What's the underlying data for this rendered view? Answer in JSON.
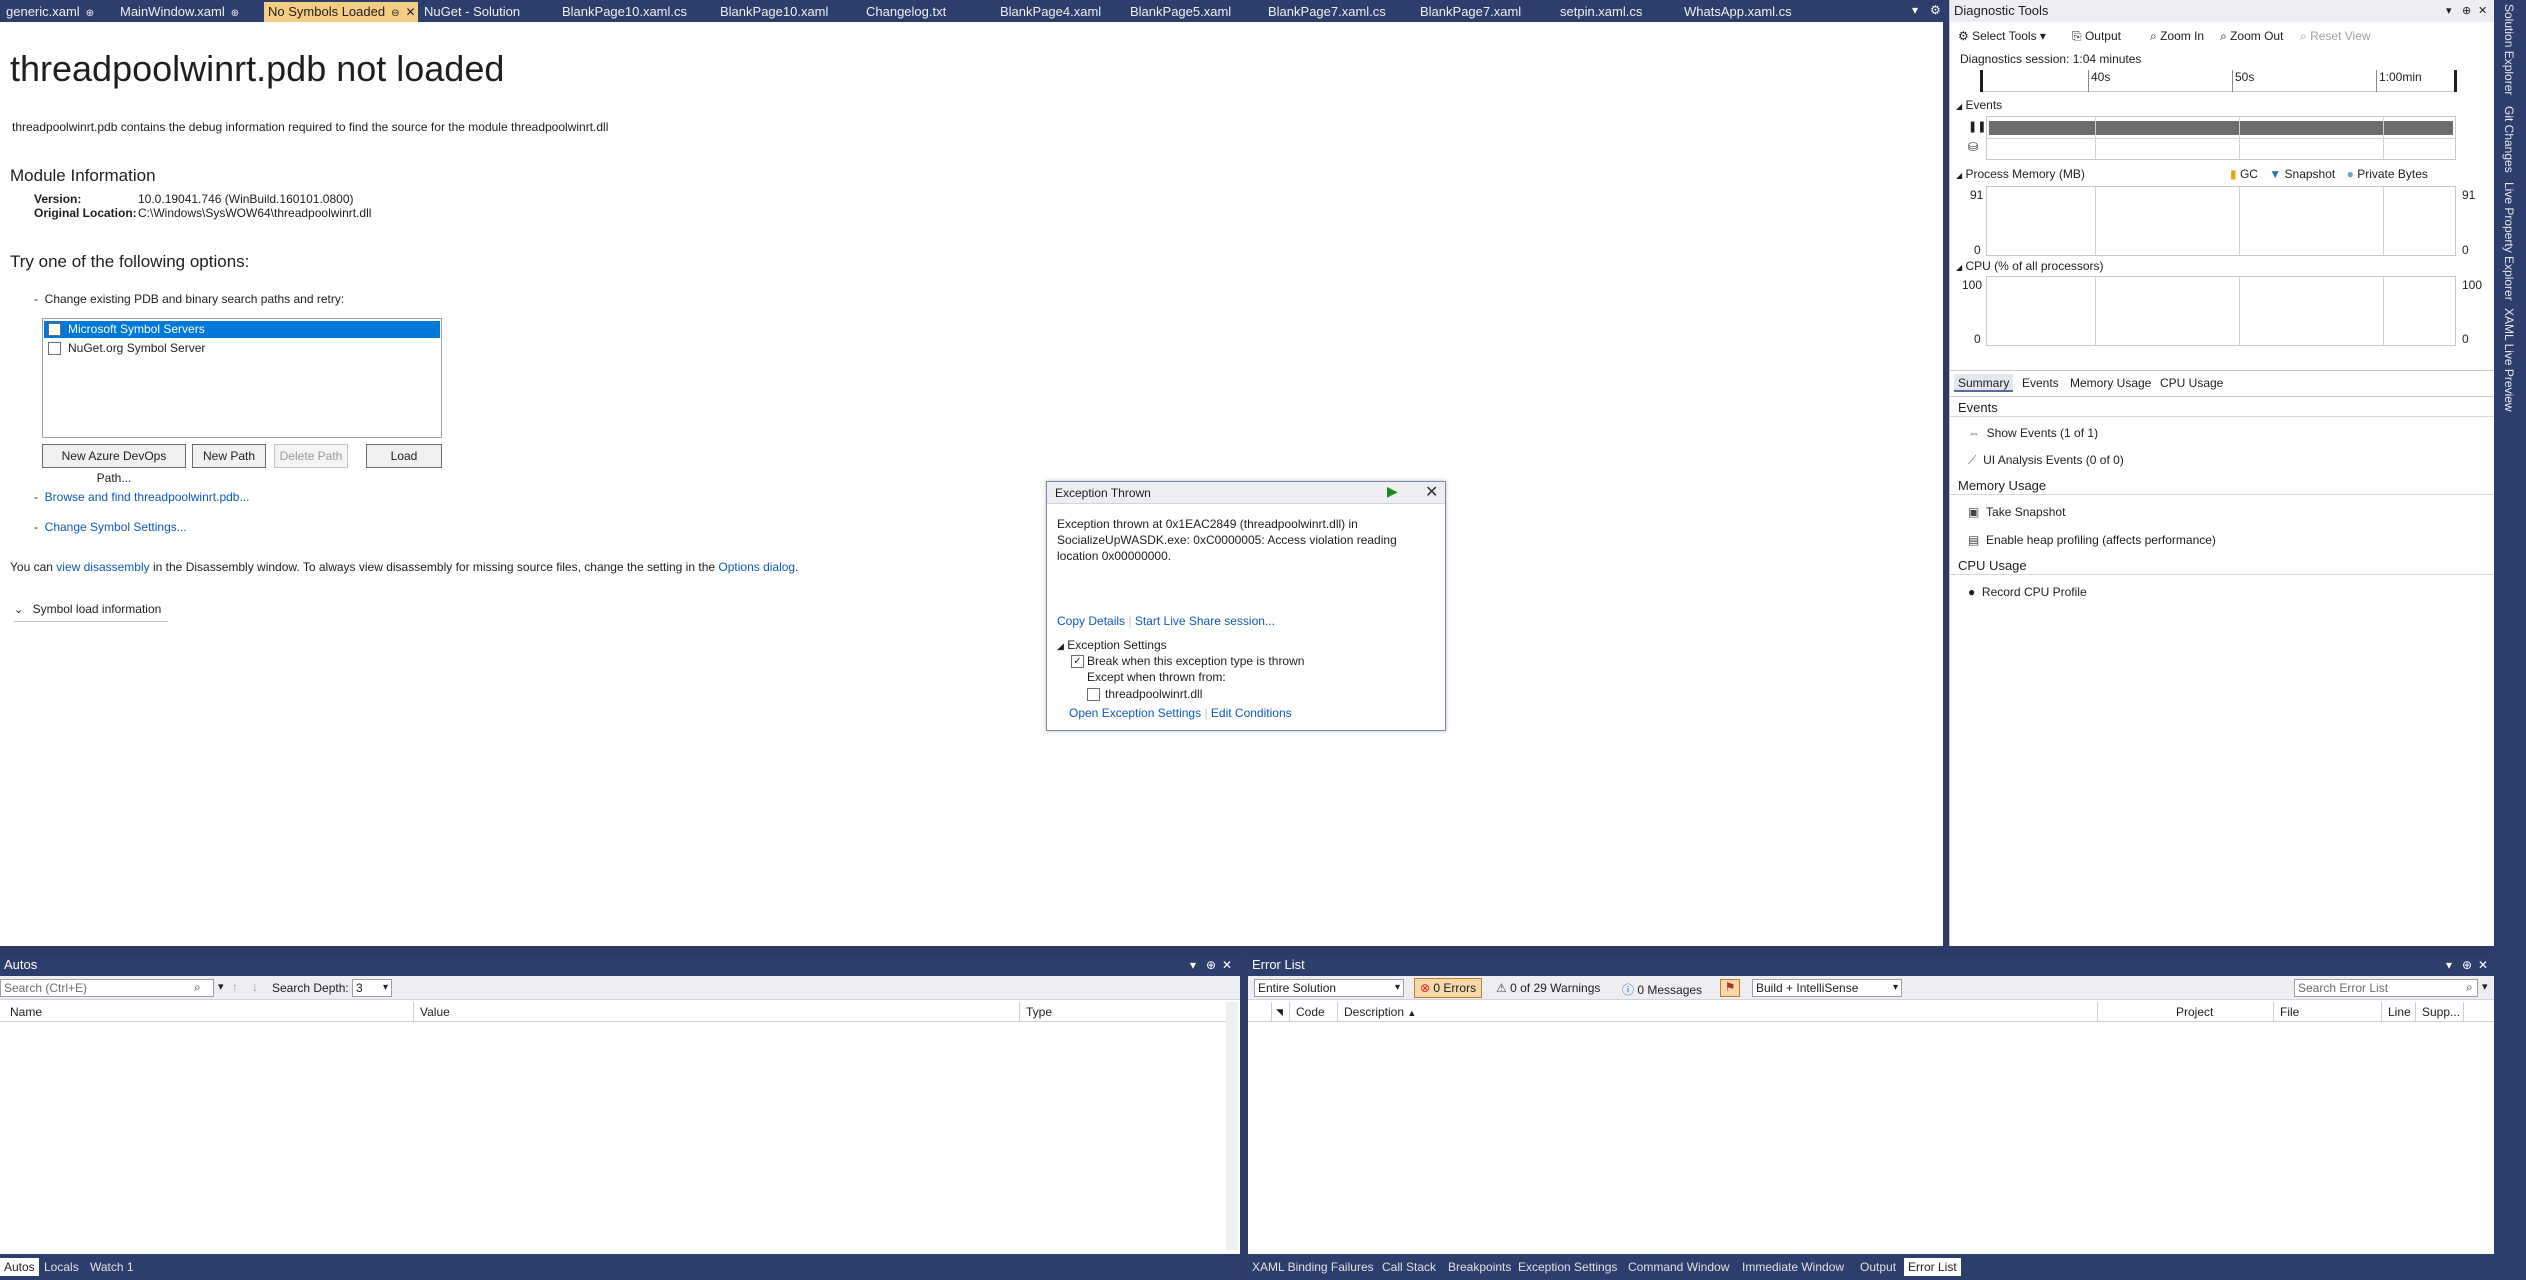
{
  "tabs": [
    {
      "label": "generic.xaml",
      "pinned": true
    },
    {
      "label": "MainWindow.xaml",
      "pinned": true
    },
    {
      "label": "No Symbols Loaded",
      "pinned": true,
      "active": true
    },
    {
      "label": "NuGet - Solution"
    },
    {
      "label": "BlankPage10.xaml.cs"
    },
    {
      "label": "BlankPage10.xaml"
    },
    {
      "label": "Changelog.txt"
    },
    {
      "label": "BlankPage4.xaml"
    },
    {
      "label": "BlankPage5.xaml"
    },
    {
      "label": "BlankPage7.xaml.cs"
    },
    {
      "label": "BlankPage7.xaml"
    },
    {
      "label": "setpin.xaml.cs"
    },
    {
      "label": "WhatsApp.xaml.cs"
    }
  ],
  "doc": {
    "title": "threadpoolwinrt.pdb not loaded",
    "description": "threadpoolwinrt.pdb contains the debug information required to find the source for the module threadpoolwinrt.dll",
    "module_heading": "Module Information",
    "version_label": "Version:",
    "version_value": "10.0.19041.746 (WinBuild.160101.0800)",
    "location_label": "Original Location:",
    "location_value": "C:\\Windows\\SysWOW64\\threadpoolwinrt.dll",
    "options_heading": "Try one of the following options:",
    "change_paths": "Change existing PDB and binary search paths and retry:",
    "servers": [
      "Microsoft Symbol Servers",
      "NuGet.org Symbol Server"
    ],
    "buttons": {
      "azure": "New Azure DevOps Path...",
      "new_path": "New Path",
      "delete_path": "Delete Path",
      "load": "Load"
    },
    "browse_link": "Browse and find threadpoolwinrt.pdb...",
    "symbol_settings_link": "Change Symbol Settings...",
    "disasm_pre": "You can",
    "disasm_link": "view disassembly",
    "disasm_mid": "in the Disassembly window. To always view disassembly for missing source files, change the setting in the",
    "options_link": "Options dialog",
    "disasm_end": ".",
    "symbol_load_info": "Symbol load information"
  },
  "exception": {
    "title": "Exception Thrown",
    "message": "Exception thrown at 0x1EAC2849 (threadpoolwinrt.dll) in SocializeUpWASDK.exe: 0xC0000005: Access violation reading location 0x00000000.",
    "copy_details": "Copy Details",
    "live_share": "Start Live Share session...",
    "settings_heading": "Exception Settings",
    "break_when": "Break when this exception type is thrown",
    "except_when": "Except when thrown from:",
    "module": "threadpoolwinrt.dll",
    "open_settings": "Open Exception Settings",
    "edit_conditions": "Edit Conditions"
  },
  "diag": {
    "title": "Diagnostic Tools",
    "select_tools": "Select Tools",
    "output": "Output",
    "zoom_in": "Zoom In",
    "zoom_out": "Zoom Out",
    "reset_view": "Reset View",
    "session": "Diagnostics session: 1:04 minutes",
    "ticks": [
      "40s",
      "50s",
      "1:00min"
    ],
    "events": "Events",
    "memory": "Process Memory (MB)",
    "gc": "GC",
    "snapshot": "Snapshot",
    "private_bytes": "Private Bytes",
    "mem_max": "91",
    "mem_min": "0",
    "cpu": "CPU (% of all processors)",
    "cpu_max": "100",
    "cpu_min": "0",
    "subtabs": [
      "Summary",
      "Events",
      "Memory Usage",
      "CPU Usage"
    ],
    "sec_events": "Events",
    "show_events": "Show Events (1 of 1)",
    "ui_events": "UI Analysis Events (0 of 0)",
    "sec_memory": "Memory Usage",
    "take_snapshot": "Take Snapshot",
    "heap_profiling": "Enable heap profiling (affects performance)",
    "sec_cpu": "CPU Usage",
    "record_cpu": "Record CPU Profile"
  },
  "sidebar_labels": [
    "Solution Explorer",
    "Git Changes",
    "Live Property Explorer",
    "XAML Live Preview"
  ],
  "autos": {
    "title": "Autos",
    "search_placeholder": "Search (Ctrl+E)",
    "search_depth_label": "Search Depth:",
    "search_depth": "3",
    "columns": [
      "Name",
      "Value",
      "Type"
    ]
  },
  "errors": {
    "title": "Error List",
    "scope": "Entire Solution",
    "errors": "0 Errors",
    "warnings": "0 of 29 Warnings",
    "messages": "0 Messages",
    "build": "Build + IntelliSense",
    "search_placeholder": "Search Error List",
    "columns": [
      "Code",
      "Description",
      "Project",
      "File",
      "Line",
      "Supp..."
    ]
  },
  "bottom_tabs_left": [
    "Autos",
    "Locals",
    "Watch 1"
  ],
  "bottom_tabs_right": [
    "XAML Binding Failures",
    "Call Stack",
    "Breakpoints",
    "Exception Settings",
    "Command Window",
    "Immediate Window",
    "Output",
    "Error List"
  ],
  "colors": {
    "chrome": "#2c3e6b",
    "active_tab": "#f5cc84",
    "selection": "#0078d7",
    "link": "#0e58b8"
  }
}
